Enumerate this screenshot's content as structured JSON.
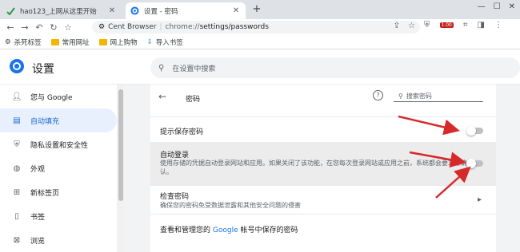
{
  "tabs": [
    {
      "title": "hao123_上网从这里开始",
      "icon": "hao123-icon"
    },
    {
      "title": "设置 - 密码",
      "icon": "settings-gear-icon"
    }
  ],
  "toolbar": {
    "brand": "Cent Browser",
    "url_prefix": "chrome://",
    "url_path": "settings/passwords",
    "ext_badge": "1.00"
  },
  "bookmarks": [
    {
      "label": "杀死标签",
      "icon": "settings-icon"
    },
    {
      "label": "常用网址",
      "icon": "folder-icon"
    },
    {
      "label": "网上购物",
      "icon": "folder-icon"
    },
    {
      "label": "导入书签",
      "icon": "import-icon"
    }
  ],
  "settings": {
    "title": "设置",
    "search_placeholder": "在设置中搜索"
  },
  "sidebar": {
    "items": [
      {
        "label": "您与 Google",
        "icon": "person-icon"
      },
      {
        "label": "自动填充",
        "icon": "clipboard-icon",
        "active": true
      },
      {
        "label": "隐私设置和安全性",
        "icon": "shield-icon"
      },
      {
        "label": "外观",
        "icon": "palette-icon"
      },
      {
        "label": "新标签页",
        "icon": "new-tab-icon"
      },
      {
        "label": "书签",
        "icon": "bookmark-icon"
      },
      {
        "label": "浏览",
        "icon": "browse-icon"
      }
    ]
  },
  "passwords": {
    "title": "密码",
    "search_placeholder": "搜索密码",
    "offer_save": {
      "label": "提示保存密码",
      "enabled": false
    },
    "auto_signin": {
      "label": "自动登录",
      "desc": "使用存储的凭据自动登录网站和应用。如果关闭了该功能，在您每次登录网站或应用之前，系统都会要求您确认。",
      "enabled": false
    },
    "check": {
      "label": "检查密码",
      "desc": "确保您的密码免受数据泄露和其他安全问题的侵害"
    },
    "manage": {
      "prefix": "查看和管理您的",
      "link": "Google",
      "suffix": "帐号中保存的密码"
    }
  },
  "colors": {
    "accent": "#1a73e8",
    "arrow": "#d62a2a"
  }
}
